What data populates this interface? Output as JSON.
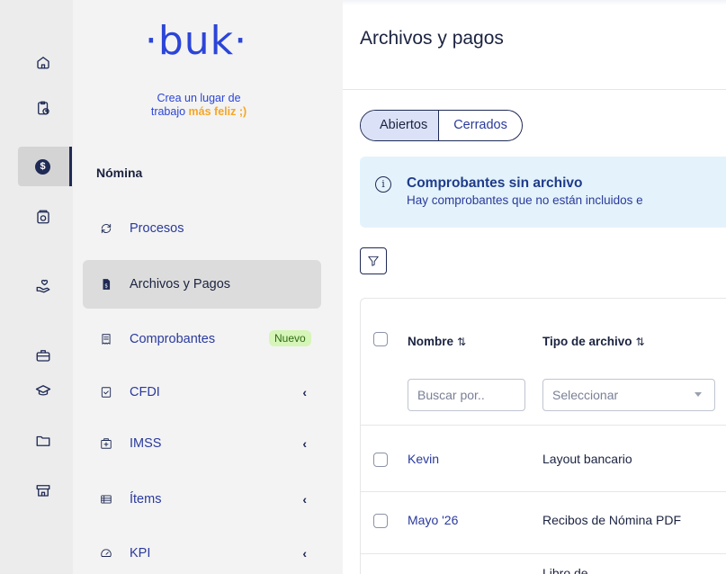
{
  "rail": {
    "items": [
      {
        "icon": "home-icon"
      },
      {
        "icon": "clipboard-clock-icon"
      },
      {
        "icon": "payroll-coin-icon",
        "active": true
      },
      {
        "icon": "vault-icon"
      },
      {
        "icon": "hand-heart-icon"
      },
      {
        "icon": "briefcase-icon"
      },
      {
        "icon": "graduation-cap-icon"
      },
      {
        "icon": "folder-icon"
      },
      {
        "icon": "store-icon"
      }
    ],
    "active_glyph": "$"
  },
  "brand": {
    "logo_text": "·buk·",
    "tagline_line1": "Crea un lugar de",
    "tagline_line2_prefix": "trabajo ",
    "tagline_highlight": "más feliz ;)"
  },
  "sidebar": {
    "section_title": "Nómina",
    "items": [
      {
        "label": "Procesos",
        "icon": "refresh-icon"
      },
      {
        "label": "Archivos y Pagos",
        "icon": "file-dollar-icon",
        "active": true
      },
      {
        "label": "Comprobantes",
        "icon": "receipt-icon",
        "badge": "Nuevo"
      },
      {
        "label": "CFDI",
        "icon": "file-check-icon",
        "chevron": "‹"
      },
      {
        "label": "IMSS",
        "icon": "medical-icon",
        "chevron": "‹"
      },
      {
        "label": "Ítems",
        "icon": "list-icon",
        "chevron": "‹"
      },
      {
        "label": "KPI",
        "icon": "gauge-icon",
        "chevron": "‹"
      }
    ]
  },
  "main": {
    "title": "Archivos y pagos",
    "tabs": [
      "Abiertos",
      "Cerrados"
    ],
    "alert": {
      "icon": "i",
      "title": "Comprobantes sin archivo",
      "text": "Hay comprobantes que no están incluidos e"
    },
    "table": {
      "columns": [
        "Nombre",
        "Tipo de archivo"
      ],
      "sort_glyph": "⇅",
      "search_placeholder": "Buscar por..",
      "select_placeholder": "Seleccionar",
      "rows": [
        {
          "name": "Kevin",
          "type": "Layout bancario"
        },
        {
          "name": "Mayo '26",
          "type": "Recibos de Nómina PDF"
        },
        {
          "name": "",
          "type": "Libro de"
        }
      ]
    }
  },
  "colors": {
    "brand_blue": "#2b45d8",
    "accent_yellow": "#f5a623",
    "navy": "#1f2a55"
  }
}
